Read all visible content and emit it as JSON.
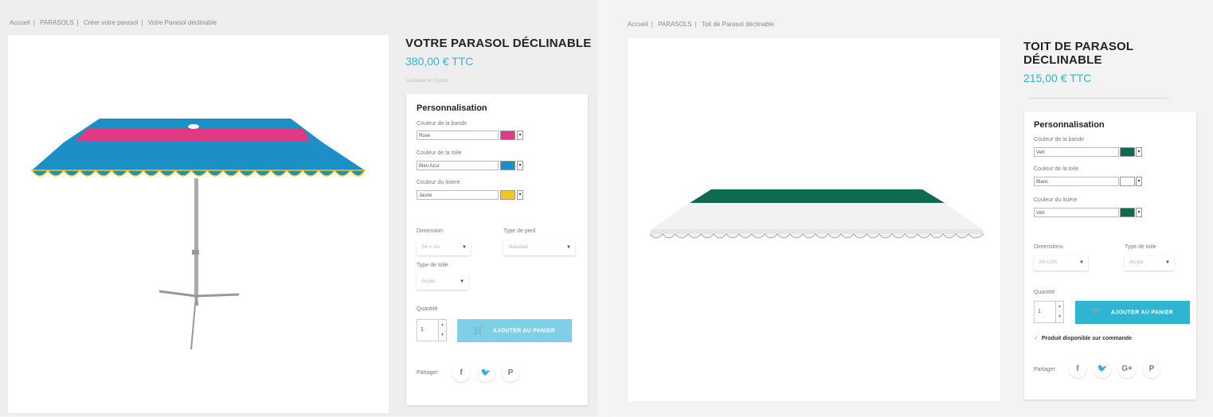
{
  "left": {
    "breadcrumb": [
      "Accueil",
      "PARASOLS",
      "Créer votre parasol",
      "Votre Parasol déclinable"
    ],
    "title": "VOTRE PARASOL DÉCLINABLE",
    "price": "380,00 € TTC",
    "subtext": "Livraison en 5 jours",
    "card": {
      "heading": "Personnalisation",
      "fields": [
        {
          "label": "Couleur de la bande",
          "value": "Rose",
          "color": "#e23a82"
        },
        {
          "label": "Couleur de la toile",
          "value": "Bleu Azur",
          "color": "#1c8fc6"
        },
        {
          "label": "Couleur du lisière",
          "value": "Jaune",
          "color": "#f2c61a"
        }
      ],
      "dropdowns": [
        {
          "label": "Dimension",
          "value": "2m x 2m"
        },
        {
          "label": "Type de pied",
          "value": "Standard"
        },
        {
          "label": "Type de toile",
          "value": "Acrylic"
        }
      ],
      "quantity_label": "Quantité",
      "quantity": "1",
      "add_to_cart": "AJOUTER AU PANIER",
      "button_color": "#7fd0e6",
      "share_label": "Partager",
      "social": [
        "f",
        "🐦",
        "P"
      ]
    },
    "colors": {
      "stripe": "#e23a82",
      "canopy": "#1c8fc6",
      "fringe": "#f2c61a"
    }
  },
  "right": {
    "breadcrumb": [
      "Accueil",
      "PARASOLS",
      "Toit de Parasol déclinable"
    ],
    "title_line1": "TOIT DE PARASOL",
    "title_line2": "DÉCLINABLE",
    "price": "215,00 € TTC",
    "card": {
      "heading": "Personnalisation",
      "fields": [
        {
          "label": "Couleur de la bande",
          "value": "Vert",
          "color": "#0f6a52"
        },
        {
          "label": "Couleur de la toile",
          "value": "Blanc",
          "color": "#ffffff"
        },
        {
          "label": "Couleur du lisière",
          "value": "Vert",
          "color": "#0f6a52"
        }
      ],
      "dropdowns": [
        {
          "label": "Dimensions",
          "value": "2m x 2m"
        },
        {
          "label": "Type de toile",
          "value": "Acrylic"
        }
      ],
      "quantity_label": "Quantité",
      "quantity": "1",
      "add_to_cart": "AJOUTER AU PANIER",
      "button_color": "#2fb5d2",
      "availability": "Produit disponible sur commande",
      "share_label": "Partager",
      "social": [
        "f",
        "🐦",
        "G+",
        "P"
      ]
    },
    "colors": {
      "stripe": "#0f6a52",
      "canopy": "#ffffff"
    }
  }
}
